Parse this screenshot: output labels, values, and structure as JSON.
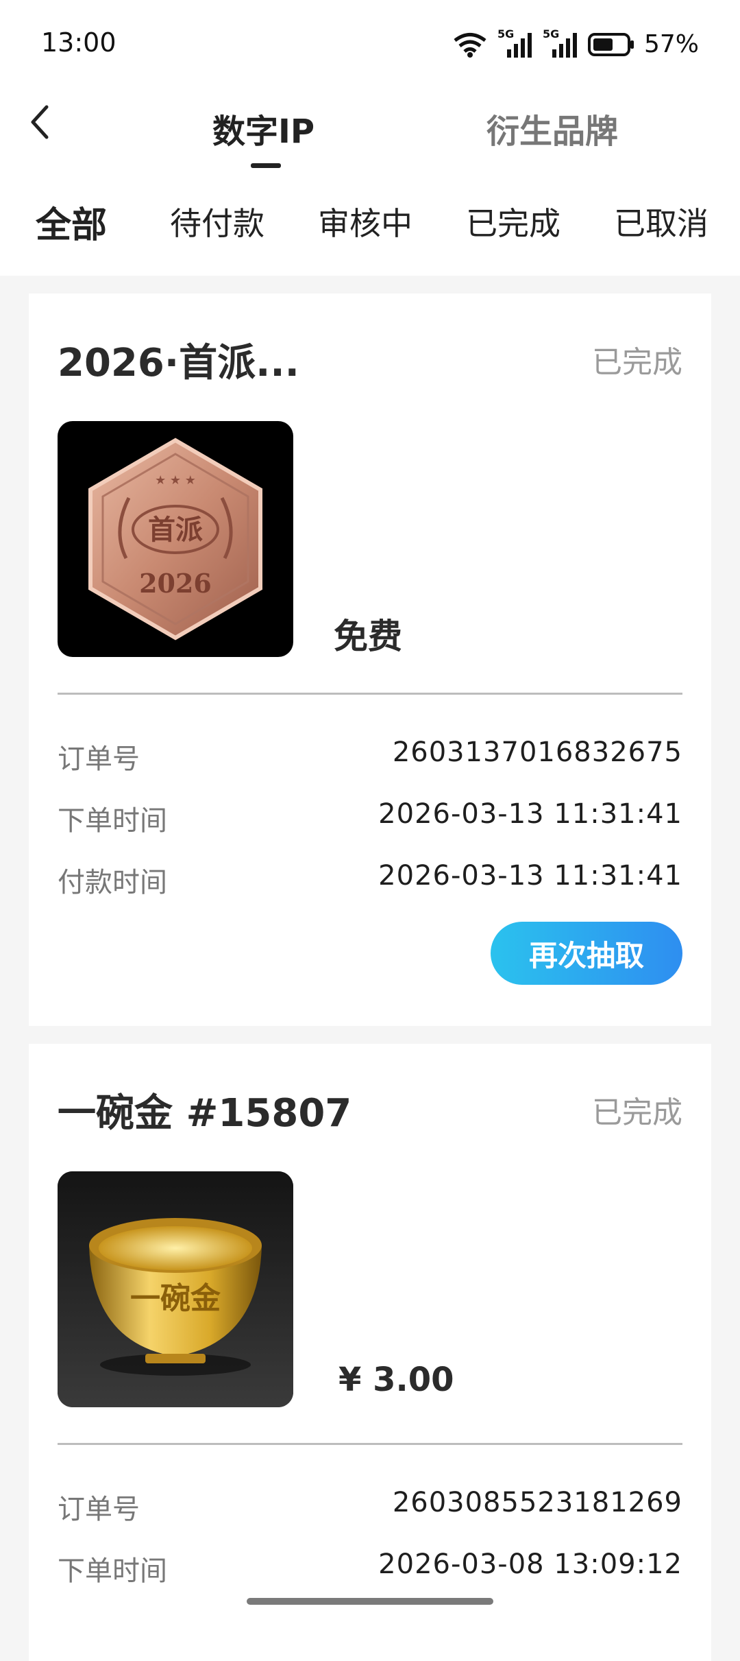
{
  "status_bar": {
    "time": "13:00",
    "signal1": "5G",
    "signal2": "5G",
    "battery": "57%"
  },
  "header": {
    "back_icon": "chevron-left-icon",
    "tabs": [
      {
        "label": "数字IP",
        "active": true
      },
      {
        "label": "衍生品牌",
        "active": false
      }
    ]
  },
  "filters": [
    "全部",
    "待付款",
    "审核中",
    "已完成",
    "已取消"
  ],
  "orders": [
    {
      "title": "2026·首派...",
      "status": "已完成",
      "image_label": "首派",
      "image_year": "2026",
      "price": "免费",
      "order_no_label": "订单号",
      "order_no": "2603137016832675",
      "order_time_label": "下单时间",
      "order_time": "2026-03-13 11:31:41",
      "pay_time_label": "付款时间",
      "pay_time": "2026-03-13 11:31:41",
      "action": "再次抽取"
    },
    {
      "title": "一碗金  #15807",
      "status": "已完成",
      "image_label": "一碗金",
      "price": "¥ 3.00",
      "order_no_label": "订单号",
      "order_no": "2603085523181269",
      "order_time_label": "下单时间",
      "order_time": "2026-03-08 13:09:12"
    }
  ],
  "colors": {
    "accent_start": "#2bc2ee",
    "accent_end": "#2e8ef0",
    "status_gray": "#9a9a9a"
  }
}
